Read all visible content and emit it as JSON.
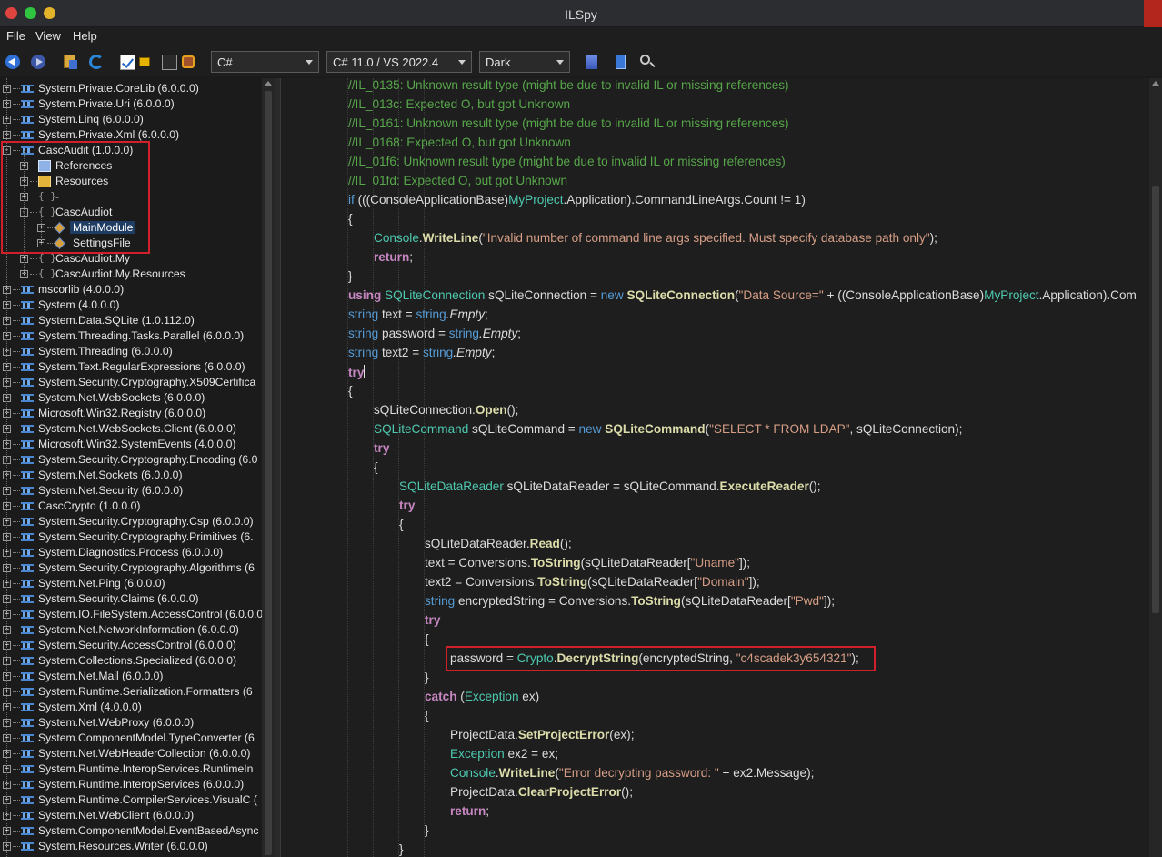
{
  "window": {
    "title": "ILSpy"
  },
  "menu": [
    "File",
    "View",
    "Help"
  ],
  "toolbar": {
    "language": "C#",
    "language_version": "C# 11.0 / VS 2022.4",
    "theme": "Dark",
    "show_public_only_checked": true,
    "icons": [
      "back-icon",
      "forward-icon",
      "open-icon",
      "refresh-icon",
      "checkbox-icon",
      "lock-icon",
      "checkbox-icon",
      "key-icon",
      "sort-icon",
      "document-icon",
      "search-icon"
    ]
  },
  "tree": {
    "selected": "MainModule",
    "rows": [
      {
        "label": "System.Private.CoreLib (6.0.0.0)",
        "depth": 0,
        "icon": "assembly-icon",
        "expander": "+"
      },
      {
        "label": "System.Private.Uri (6.0.0.0)",
        "depth": 0,
        "icon": "assembly-icon",
        "expander": "+"
      },
      {
        "label": "System.Linq (6.0.0.0)",
        "depth": 0,
        "icon": "assembly-icon",
        "expander": "+"
      },
      {
        "label": "System.Private.Xml (6.0.0.0)",
        "depth": 0,
        "icon": "assembly-icon",
        "expander": "+"
      },
      {
        "label": "CascAudit (1.0.0.0)",
        "depth": 0,
        "icon": "assembly-icon",
        "expander": "-"
      },
      {
        "label": "References",
        "depth": 1,
        "icon": "references-icon",
        "expander": "+"
      },
      {
        "label": "Resources",
        "depth": 1,
        "icon": "resources-icon",
        "expander": "+"
      },
      {
        "label": "-",
        "depth": 1,
        "icon": "namespace-icon",
        "expander": "+"
      },
      {
        "label": "CascAudiot",
        "depth": 1,
        "icon": "namespace-icon",
        "expander": "-"
      },
      {
        "label": "MainModule",
        "depth": 2,
        "icon": "class-icon",
        "expander": "+"
      },
      {
        "label": "SettingsFile",
        "depth": 2,
        "icon": "class-icon",
        "expander": "+"
      },
      {
        "label": "CascAudiot.My",
        "depth": 1,
        "icon": "namespace-icon",
        "expander": "+"
      },
      {
        "label": "CascAudiot.My.Resources",
        "depth": 1,
        "icon": "namespace-icon",
        "expander": "+"
      },
      {
        "label": "mscorlib (4.0.0.0)",
        "depth": 0,
        "icon": "assembly-icon",
        "expander": "+"
      },
      {
        "label": "System (4.0.0.0)",
        "depth": 0,
        "icon": "assembly-icon",
        "expander": "+"
      },
      {
        "label": "System.Data.SQLite (1.0.112.0)",
        "depth": 0,
        "icon": "assembly-icon",
        "expander": "+"
      },
      {
        "label": "System.Threading.Tasks.Parallel (6.0.0.0)",
        "depth": 0,
        "icon": "assembly-icon",
        "expander": "+"
      },
      {
        "label": "System.Threading (6.0.0.0)",
        "depth": 0,
        "icon": "assembly-icon",
        "expander": "+"
      },
      {
        "label": "System.Text.RegularExpressions (6.0.0.0)",
        "depth": 0,
        "icon": "assembly-icon",
        "expander": "+"
      },
      {
        "label": "System.Security.Cryptography.X509Certifica",
        "depth": 0,
        "icon": "assembly-icon",
        "expander": "+"
      },
      {
        "label": "System.Net.WebSockets (6.0.0.0)",
        "depth": 0,
        "icon": "assembly-icon",
        "expander": "+"
      },
      {
        "label": "Microsoft.Win32.Registry (6.0.0.0)",
        "depth": 0,
        "icon": "assembly-icon",
        "expander": "+"
      },
      {
        "label": "System.Net.WebSockets.Client (6.0.0.0)",
        "depth": 0,
        "icon": "assembly-icon",
        "expander": "+"
      },
      {
        "label": "Microsoft.Win32.SystemEvents (4.0.0.0)",
        "depth": 0,
        "icon": "assembly-icon",
        "expander": "+"
      },
      {
        "label": "System.Security.Cryptography.Encoding (6.0",
        "depth": 0,
        "icon": "assembly-icon",
        "expander": "+"
      },
      {
        "label": "System.Net.Sockets (6.0.0.0)",
        "depth": 0,
        "icon": "assembly-icon",
        "expander": "+"
      },
      {
        "label": "System.Net.Security (6.0.0.0)",
        "depth": 0,
        "icon": "assembly-icon",
        "expander": "+"
      },
      {
        "label": "CascCrypto (1.0.0.0)",
        "depth": 0,
        "icon": "assembly-icon",
        "expander": "+"
      },
      {
        "label": "System.Security.Cryptography.Csp (6.0.0.0)",
        "depth": 0,
        "icon": "assembly-icon",
        "expander": "+"
      },
      {
        "label": "System.Security.Cryptography.Primitives (6.",
        "depth": 0,
        "icon": "assembly-icon",
        "expander": "+"
      },
      {
        "label": "System.Diagnostics.Process (6.0.0.0)",
        "depth": 0,
        "icon": "assembly-icon",
        "expander": "+"
      },
      {
        "label": "System.Security.Cryptography.Algorithms (6",
        "depth": 0,
        "icon": "assembly-icon",
        "expander": "+"
      },
      {
        "label": "System.Net.Ping (6.0.0.0)",
        "depth": 0,
        "icon": "assembly-icon",
        "expander": "+"
      },
      {
        "label": "System.Security.Claims (6.0.0.0)",
        "depth": 0,
        "icon": "assembly-icon",
        "expander": "+"
      },
      {
        "label": "System.IO.FileSystem.AccessControl (6.0.0.0",
        "depth": 0,
        "icon": "assembly-icon",
        "expander": "+"
      },
      {
        "label": "System.Net.NetworkInformation (6.0.0.0)",
        "depth": 0,
        "icon": "assembly-icon",
        "expander": "+"
      },
      {
        "label": "System.Security.AccessControl (6.0.0.0)",
        "depth": 0,
        "icon": "assembly-icon",
        "expander": "+"
      },
      {
        "label": "System.Collections.Specialized (6.0.0.0)",
        "depth": 0,
        "icon": "assembly-icon",
        "expander": "+"
      },
      {
        "label": "System.Net.Mail (6.0.0.0)",
        "depth": 0,
        "icon": "assembly-icon",
        "expander": "+"
      },
      {
        "label": "System.Runtime.Serialization.Formatters (6",
        "depth": 0,
        "icon": "assembly-icon",
        "expander": "+"
      },
      {
        "label": "System.Xml (4.0.0.0)",
        "depth": 0,
        "icon": "assembly-icon",
        "expander": "+"
      },
      {
        "label": "System.Net.WebProxy (6.0.0.0)",
        "depth": 0,
        "icon": "assembly-icon",
        "expander": "+"
      },
      {
        "label": "System.ComponentModel.TypeConverter (6",
        "depth": 0,
        "icon": "assembly-icon",
        "expander": "+"
      },
      {
        "label": "System.Net.WebHeaderCollection (6.0.0.0)",
        "depth": 0,
        "icon": "assembly-icon",
        "expander": "+"
      },
      {
        "label": "System.Runtime.InteropServices.RuntimeIn",
        "depth": 0,
        "icon": "assembly-icon",
        "expander": "+"
      },
      {
        "label": "System.Runtime.InteropServices (6.0.0.0)",
        "depth": 0,
        "icon": "assembly-icon",
        "expander": "+"
      },
      {
        "label": "System.Runtime.CompilerServices.VisualC (",
        "depth": 0,
        "icon": "assembly-icon",
        "expander": "+"
      },
      {
        "label": "System.Net.WebClient (6.0.0.0)",
        "depth": 0,
        "icon": "assembly-icon",
        "expander": "+"
      },
      {
        "label": "System.ComponentModel.EventBasedAsync",
        "depth": 0,
        "icon": "assembly-icon",
        "expander": "+"
      },
      {
        "label": "System.Resources.Writer (6.0.0.0)",
        "depth": 0,
        "icon": "assembly-icon",
        "expander": "+"
      }
    ]
  },
  "code": {
    "lines": [
      {
        "indent": 0,
        "tokens": [
          [
            "cm",
            "//IL_0135: Unknown result type (might be due to invalid IL or missing references)"
          ]
        ]
      },
      {
        "indent": 0,
        "tokens": [
          [
            "cm",
            "//IL_013c: Expected O, but got Unknown"
          ]
        ]
      },
      {
        "indent": 0,
        "tokens": [
          [
            "cm",
            "//IL_0161: Unknown result type (might be due to invalid IL or missing references)"
          ]
        ]
      },
      {
        "indent": 0,
        "tokens": [
          [
            "cm",
            "//IL_0168: Expected O, but got Unknown"
          ]
        ]
      },
      {
        "indent": 0,
        "tokens": [
          [
            "cm",
            "//IL_01f6: Unknown result type (might be due to invalid IL or missing references)"
          ]
        ]
      },
      {
        "indent": 0,
        "tokens": [
          [
            "cm",
            "//IL_01fd: Expected O, but got Unknown"
          ]
        ]
      },
      {
        "indent": 0,
        "tokens": [
          [
            "kw",
            "if"
          ],
          [
            "",
            " ((("
          ],
          [
            "",
            "ConsoleApplicationBase"
          ],
          [
            "",
            ")"
          ],
          [
            "ty",
            "MyProject"
          ],
          [
            "",
            ".Application).CommandLineArgs.Count != 1)"
          ]
        ]
      },
      {
        "indent": 0,
        "tokens": [
          [
            "",
            "{"
          ]
        ]
      },
      {
        "indent": 1,
        "tokens": [
          [
            "ty",
            "Console"
          ],
          [
            "",
            "."
          ],
          [
            "mt",
            "WriteLine"
          ],
          [
            "",
            "("
          ],
          [
            "st",
            "\"Invalid number of command line args specified. Must specify database path only\""
          ],
          [
            "",
            ");"
          ]
        ]
      },
      {
        "indent": 1,
        "tokens": [
          [
            "kw2",
            "return"
          ],
          [
            "",
            ";"
          ]
        ]
      },
      {
        "indent": 0,
        "tokens": [
          [
            "",
            "}"
          ]
        ]
      },
      {
        "indent": 0,
        "tokens": [
          [
            "kw2",
            "using"
          ],
          [
            "",
            " "
          ],
          [
            "ty",
            "SQLiteConnection"
          ],
          [
            "",
            " sQLiteConnection = "
          ],
          [
            "kw",
            "new"
          ],
          [
            "",
            " "
          ],
          [
            "mt",
            "SQLiteConnection"
          ],
          [
            "",
            "("
          ],
          [
            "st",
            "\"Data Source=\""
          ],
          [
            "",
            " + (("
          ],
          [
            "",
            "ConsoleApplicationBase"
          ],
          [
            "",
            ")"
          ],
          [
            "ty",
            "MyProject"
          ],
          [
            "",
            ".Application).Com"
          ]
        ]
      },
      {
        "indent": 0,
        "tokens": [
          [
            "kw",
            "string"
          ],
          [
            "",
            " text = "
          ],
          [
            "kw",
            "string"
          ],
          [
            "it",
            ".Empty"
          ],
          [
            "",
            ";"
          ]
        ]
      },
      {
        "indent": 0,
        "tokens": [
          [
            "kw",
            "string"
          ],
          [
            "",
            " password = "
          ],
          [
            "kw",
            "string"
          ],
          [
            "it",
            ".Empty"
          ],
          [
            "",
            ";"
          ]
        ]
      },
      {
        "indent": 0,
        "tokens": [
          [
            "kw",
            "string"
          ],
          [
            "",
            " text2 = "
          ],
          [
            "kw",
            "string"
          ],
          [
            "it",
            ".Empty"
          ],
          [
            "",
            ";"
          ]
        ]
      },
      {
        "indent": 0,
        "tokens": [
          [
            "kw2",
            "try"
          ]
        ],
        "caret": true
      },
      {
        "indent": 0,
        "tokens": [
          [
            "",
            "{"
          ]
        ]
      },
      {
        "indent": 1,
        "tokens": [
          [
            "",
            "sQLiteConnection."
          ],
          [
            "mt",
            "Open"
          ],
          [
            "",
            "();"
          ]
        ]
      },
      {
        "indent": 1,
        "tokens": [
          [
            "ty",
            "SQLiteCommand"
          ],
          [
            "",
            " sQLiteCommand = "
          ],
          [
            "kw",
            "new"
          ],
          [
            "",
            " "
          ],
          [
            "mt",
            "SQLiteCommand"
          ],
          [
            "",
            "("
          ],
          [
            "st",
            "\"SELECT * FROM LDAP\""
          ],
          [
            "",
            ", sQLiteConnection);"
          ]
        ]
      },
      {
        "indent": 1,
        "tokens": [
          [
            "kw2",
            "try"
          ]
        ]
      },
      {
        "indent": 1,
        "tokens": [
          [
            "",
            "{"
          ]
        ]
      },
      {
        "indent": 2,
        "tokens": [
          [
            "ty",
            "SQLiteDataReader"
          ],
          [
            "",
            " sQLiteDataReader = sQLiteCommand."
          ],
          [
            "mt",
            "ExecuteReader"
          ],
          [
            "",
            "();"
          ]
        ]
      },
      {
        "indent": 2,
        "tokens": [
          [
            "kw2",
            "try"
          ]
        ]
      },
      {
        "indent": 2,
        "tokens": [
          [
            "",
            "{"
          ]
        ]
      },
      {
        "indent": 3,
        "tokens": [
          [
            "",
            "sQLiteDataReader."
          ],
          [
            "mt",
            "Read"
          ],
          [
            "",
            "();"
          ]
        ]
      },
      {
        "indent": 3,
        "tokens": [
          [
            "",
            "text = Conversions."
          ],
          [
            "mt",
            "ToString"
          ],
          [
            "",
            "(sQLiteDataReader["
          ],
          [
            "st",
            "\"Uname\""
          ],
          [
            "",
            "]);"
          ]
        ]
      },
      {
        "indent": 3,
        "tokens": [
          [
            "",
            "text2 = Conversions."
          ],
          [
            "mt",
            "ToString"
          ],
          [
            "",
            "(sQLiteDataReader["
          ],
          [
            "st",
            "\"Domain\""
          ],
          [
            "",
            "]);"
          ]
        ]
      },
      {
        "indent": 3,
        "tokens": [
          [
            "kw",
            "string"
          ],
          [
            "",
            " encryptedString = Conversions."
          ],
          [
            "mt",
            "ToString"
          ],
          [
            "",
            "(sQLiteDataReader["
          ],
          [
            "st",
            "\"Pwd\""
          ],
          [
            "",
            "]);"
          ]
        ]
      },
      {
        "indent": 3,
        "tokens": [
          [
            "kw2",
            "try"
          ]
        ]
      },
      {
        "indent": 3,
        "tokens": [
          [
            "",
            "{"
          ]
        ]
      },
      {
        "indent": 4,
        "tokens": [
          [
            "",
            "password = "
          ],
          [
            "ty",
            "Crypto"
          ],
          [
            "",
            "."
          ],
          [
            "mt",
            "DecryptString"
          ],
          [
            "",
            "(encryptedString, "
          ],
          [
            "st",
            "\"c4scadek3y654321\""
          ],
          [
            "",
            ");"
          ]
        ]
      },
      {
        "indent": 3,
        "tokens": [
          [
            "",
            "}"
          ]
        ]
      },
      {
        "indent": 3,
        "tokens": [
          [
            "kw2",
            "catch"
          ],
          [
            "",
            " ("
          ],
          [
            "ty",
            "Exception"
          ],
          [
            "",
            " ex)"
          ]
        ]
      },
      {
        "indent": 3,
        "tokens": [
          [
            "",
            "{"
          ]
        ]
      },
      {
        "indent": 4,
        "tokens": [
          [
            "",
            "ProjectData."
          ],
          [
            "mt",
            "SetProjectError"
          ],
          [
            "",
            "(ex);"
          ]
        ]
      },
      {
        "indent": 4,
        "tokens": [
          [
            "ty",
            "Exception"
          ],
          [
            "",
            " ex2 = ex;"
          ]
        ]
      },
      {
        "indent": 4,
        "tokens": [
          [
            "ty",
            "Console"
          ],
          [
            "",
            "."
          ],
          [
            "mt",
            "WriteLine"
          ],
          [
            "",
            "("
          ],
          [
            "st",
            "\"Error decrypting password: \""
          ],
          [
            "",
            " + ex2.Message);"
          ]
        ]
      },
      {
        "indent": 4,
        "tokens": [
          [
            "",
            "ProjectData."
          ],
          [
            "mt",
            "ClearProjectError"
          ],
          [
            "",
            "();"
          ]
        ]
      },
      {
        "indent": 4,
        "tokens": [
          [
            "kw2",
            "return"
          ],
          [
            "",
            ";"
          ]
        ]
      },
      {
        "indent": 3,
        "tokens": [
          [
            "",
            "}"
          ]
        ]
      },
      {
        "indent": 2,
        "tokens": [
          [
            "",
            "}"
          ]
        ]
      }
    ]
  },
  "colors": {
    "comment": "#57a64a",
    "keyword": "#569cd6",
    "control_keyword": "#c586c0",
    "type": "#4ec9b0",
    "method": "#dcdcaa",
    "string": "#d69d85",
    "highlight_box": "#d0212b",
    "selection": "#1f3d63"
  }
}
